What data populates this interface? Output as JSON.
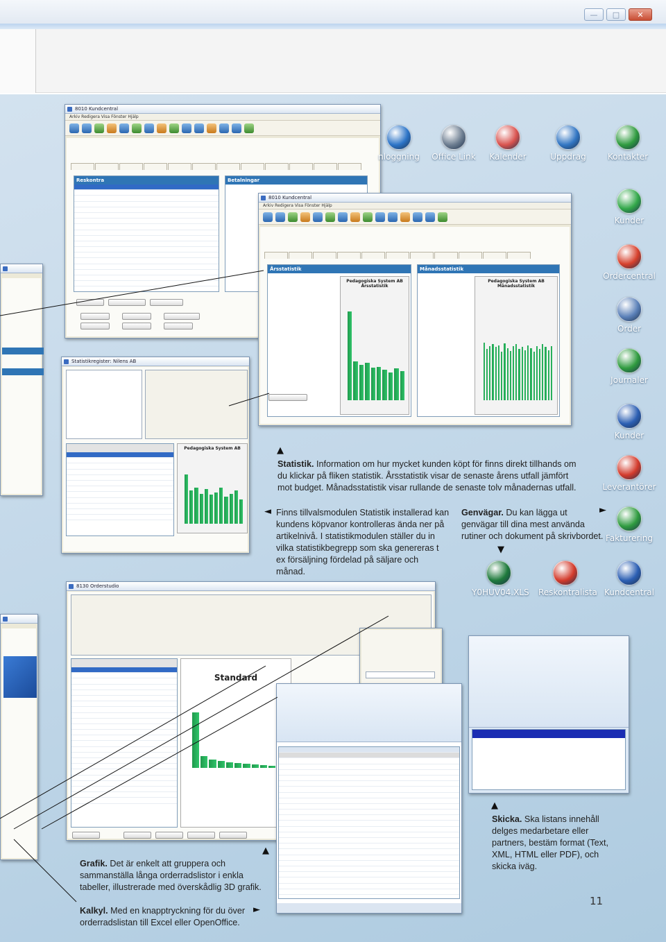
{
  "window_controls": {
    "minimize": "—",
    "maximize": "□",
    "close": "✕"
  },
  "desktop_icons": [
    {
      "label": "nloggning",
      "icon": "login-icon",
      "color": "#2c74c7"
    },
    {
      "label": "Office Link",
      "icon": "globe-icon",
      "color": "#6d7e91"
    },
    {
      "label": "Kalender",
      "icon": "calendar-icon",
      "color": "#d9534f"
    },
    {
      "label": "Uppdrag",
      "icon": "folder-icon",
      "color": "#3276c3"
    },
    {
      "label": "Kontakter",
      "icon": "contact-icon",
      "color": "#2f9b3f"
    },
    {
      "label": "Kunder",
      "icon": "customers-icon",
      "color": "#33a84a"
    },
    {
      "label": "Ordercentral",
      "icon": "project-icon",
      "color": "#d6402c"
    },
    {
      "label": "Order",
      "icon": "order-icon",
      "color": "#5a80b8"
    },
    {
      "label": "Journaler",
      "icon": "journal-icon",
      "color": "#2f9b3f"
    },
    {
      "label": "Kunder",
      "icon": "customer-user-icon",
      "color": "#2c5fb3"
    },
    {
      "label": "Leverantörer",
      "icon": "supplier-icon",
      "color": "#d33b2c"
    },
    {
      "label": "Fakturering",
      "icon": "invoice-icon",
      "color": "#2f9b3f"
    },
    {
      "label": "Y0HUV04.XLS",
      "icon": "excel-icon",
      "color": "#1e7a3c"
    },
    {
      "label": "Reskontralista",
      "icon": "printer-icon",
      "color": "#d33b2c"
    },
    {
      "label": "Kundcentral",
      "icon": "kund-icon",
      "color": "#2c5fb3"
    }
  ],
  "windows": {
    "kundcentral1": {
      "title": "8010 Kundcentral",
      "menu": "Arkiv  Redigera  Visa  Fönster  Hjälp",
      "panel_left": "Reskontra",
      "panel_right": "Betalningar"
    },
    "kundcentral2": {
      "title": "8010 Kundcentral",
      "menu": "Arkiv  Redigera  Visa  Fönster  Hjälp",
      "panel_left": "Årsstatistik",
      "panel_right": "Månadsstatistik",
      "chart_left": "Pedagogiska System AB Årsstatistik",
      "chart_right": "Pedagogiska System AB Månadsstatistik"
    },
    "statistik": {
      "title": "Statistikregister: Nilens AB",
      "chart": "Pedagogiska System AB"
    },
    "orderstudio": {
      "title": "8130 Orderstudio",
      "chart": "Standard"
    }
  },
  "captions": {
    "statistik_title": "Statistik.",
    "statistik_body": " Information om hur mycket kunden köpt för finns direkt tillhands om du klickar på fliken statistik. Årsstatistik visar de senaste årens utfall jämfört mot budget. Månadsstatistik visar rullande de senaste tolv månadernas utfall.",
    "modul_body": "Finns tillvalsmodulen Statistik installerad kan kundens köpvanor kontrolleras ända ner på artikelnivå. I statistikmodulen ställer du in vilka statistikbegrepp som ska genereras t ex försäljning fördelad på säljare och månad.",
    "genvagar_title": "Genvägar.",
    "genvagar_body": " Du kan lägga ut genvägar till dina mest använda rutiner och dokument på skrivbordet.",
    "skicka_title": "Skicka.",
    "skicka_body": " Ska listans innehåll delges medarbetare eller partners, bestäm format (Text, XML, HTML eller PDF), och skicka iväg.",
    "grafik_title": "Grafik.",
    "grafik_body": " Det är enkelt att gruppera och sammanställa långa orderradslistor i enkla tabeller, illustrerade med överskådlig 3D grafik.",
    "kalkyl_title": "Kalkyl.",
    "kalkyl_body": " Med en knapptryckning för du över orderradslistan till Excel eller OpenOffice."
  },
  "arrows": {
    "up": "▲",
    "left": "◄",
    "right": "►",
    "down": "▼"
  },
  "page_number": "11",
  "bars": {
    "arsstatistik": [
      0.95,
      0.42,
      0.38,
      0.4,
      0.35,
      0.36,
      0.33,
      0.3,
      0.34,
      0.31
    ],
    "manadsstatistik": [
      0.62,
      0.55,
      0.58,
      0.6,
      0.57,
      0.59,
      0.52,
      0.61,
      0.56,
      0.53,
      0.58,
      0.6,
      0.55,
      0.57,
      0.54,
      0.59,
      0.56,
      0.52,
      0.58,
      0.55,
      0.6,
      0.57,
      0.54,
      0.58
    ],
    "statistik": [
      0.82,
      0.55,
      0.6,
      0.5,
      0.58,
      0.48,
      0.52,
      0.6,
      0.45,
      0.5,
      0.55,
      0.4
    ],
    "orderstudio": [
      0.95,
      0.2,
      0.15,
      0.12,
      0.1,
      0.09,
      0.08,
      0.06,
      0.05,
      0.04,
      0.03
    ]
  }
}
